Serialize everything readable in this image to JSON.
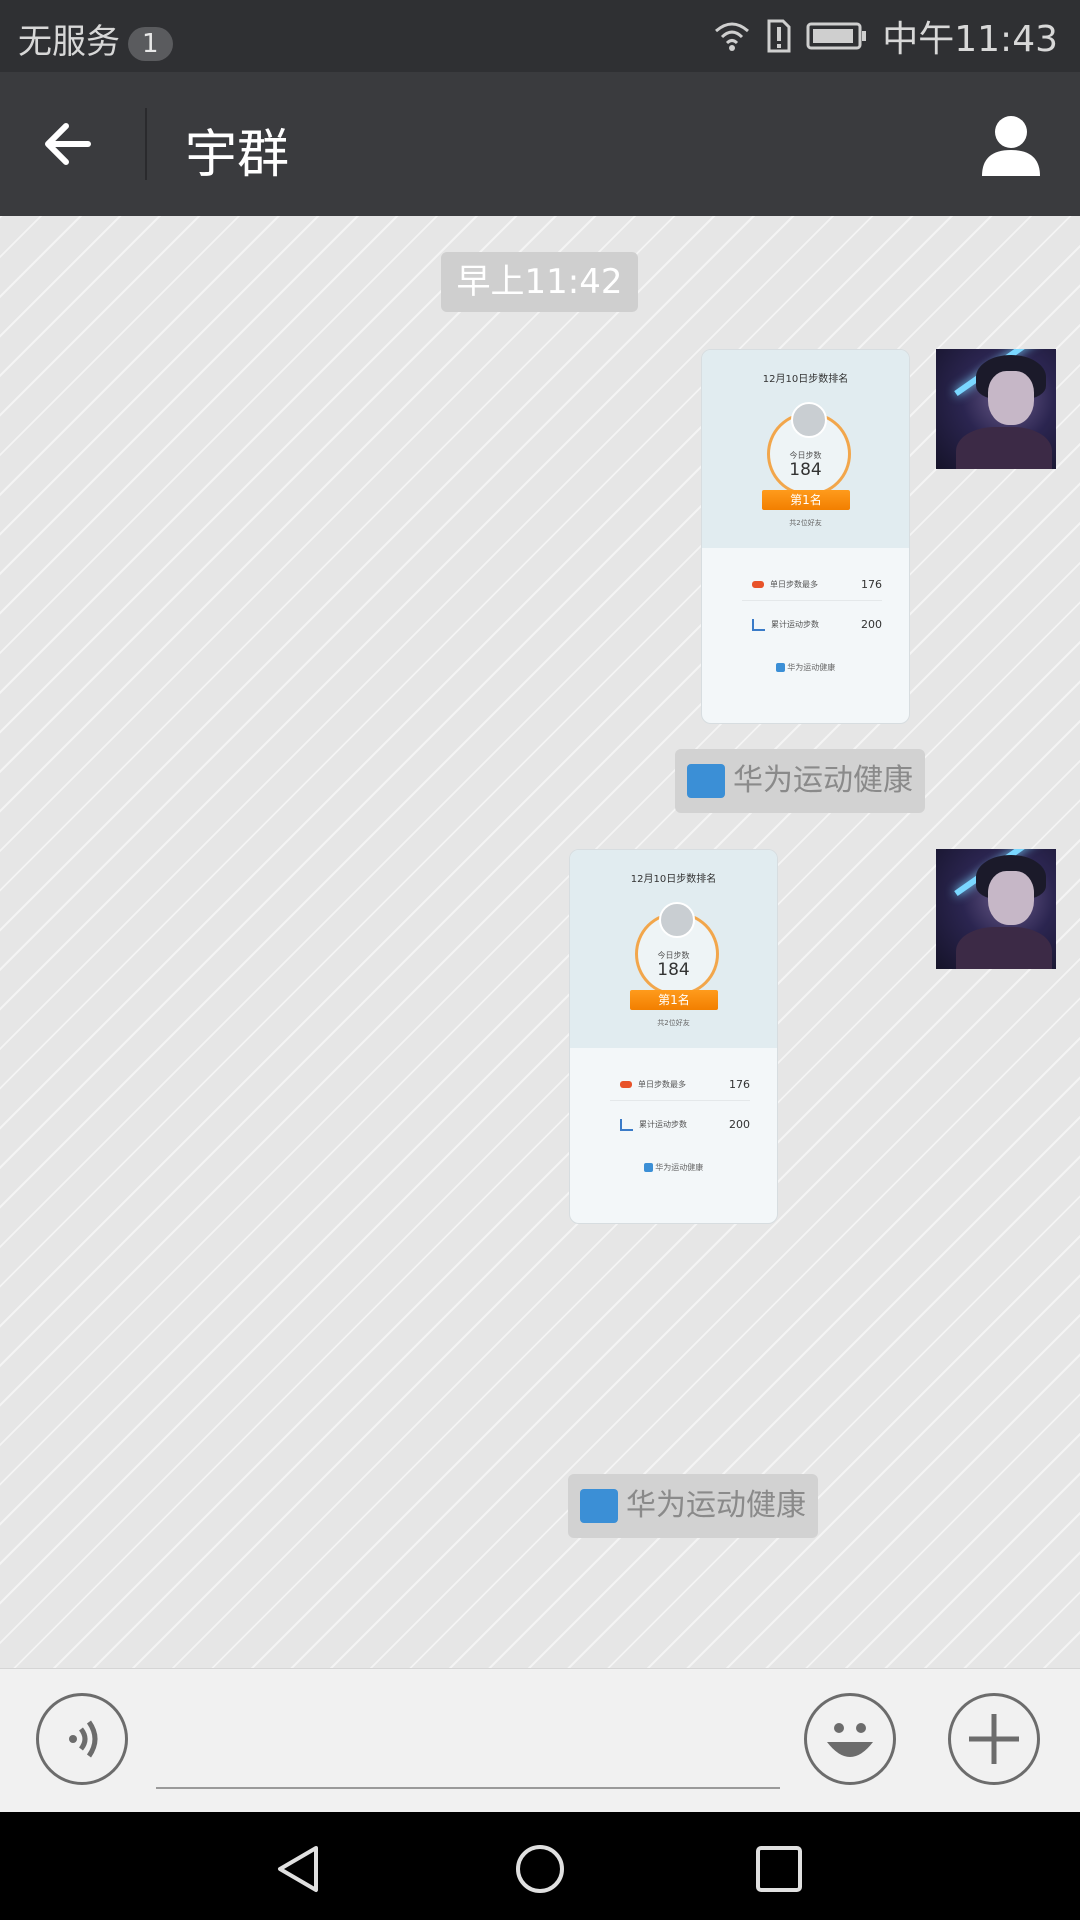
{
  "status_bar": {
    "carrier": "无服务",
    "notification_count": "1",
    "time": "中午11:43",
    "icons": [
      "wifi-icon",
      "sim-alert-icon",
      "battery-icon"
    ]
  },
  "header": {
    "title": "宇群",
    "icons": [
      "back-arrow-icon",
      "profile-icon"
    ]
  },
  "chat": {
    "timestamp": "早上11:42",
    "messages": [
      {
        "type": "card",
        "card": {
          "date_title": "12月10日步数排名",
          "steps_label": "今日步数",
          "steps": "184",
          "rank": "第1名",
          "subtitle": "共2位好友",
          "row1_label": "单日步数最多",
          "row1_value": "176",
          "row2_label": "累计运动步数",
          "row2_value": "200",
          "brand": "华为运动健康"
        },
        "source_tag": "华为运动健康"
      },
      {
        "type": "card",
        "card": {
          "date_title": "12月10日步数排名",
          "steps_label": "今日步数",
          "steps": "184",
          "rank": "第1名",
          "subtitle": "共2位好友",
          "row1_label": "单日步数最多",
          "row1_value": "176",
          "row2_label": "累计运动步数",
          "row2_value": "200",
          "brand": "华为运动健康"
        },
        "source_tag": "华为运动健康"
      }
    ]
  },
  "input_bar": {
    "icons": [
      "voice-icon",
      "emoji-icon",
      "plus-icon"
    ]
  },
  "nav_bar": {
    "icons": [
      "nav-back-icon",
      "nav-home-icon",
      "nav-recents-icon"
    ]
  },
  "colors": {
    "status_bar_bg": "#2f3033",
    "title_bar_bg": "#3a3b3e",
    "chat_bg": "#e6e6e6",
    "rank_ribbon": "#f28a00",
    "nav_bar_bg": "#000000"
  }
}
